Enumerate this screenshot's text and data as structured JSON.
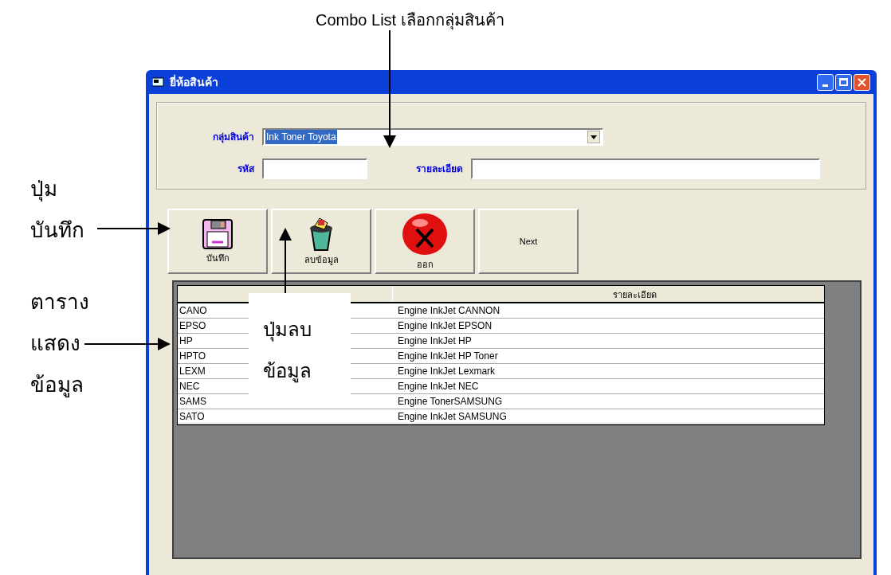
{
  "caption": "Combo List เลือกกลุ่มสินค้า",
  "side_notes": [
    {
      "lines": [
        "ปุ่ม",
        "บันทึก"
      ]
    },
    {
      "lines": [
        "ตาราง",
        "แสดง",
        "ข้อมูล"
      ]
    }
  ],
  "overlay_note": {
    "lines": [
      "ปุ่มลบ",
      "ข้อมูล"
    ]
  },
  "window": {
    "title": "ยี่ห้อสินค้า"
  },
  "form": {
    "group": {
      "label": "กลุ่มสินค้า",
      "value": "Ink Toner Toyota",
      "highlighted": true
    },
    "code": {
      "label": "รหัส"
    },
    "detail": {
      "label": "รายละเอียด"
    }
  },
  "buttons": [
    {
      "kind": "save",
      "label": "บันทึก"
    },
    {
      "kind": "delete",
      "label": "ลบข้อมูล"
    },
    {
      "kind": "exit",
      "label": "ออก"
    },
    {
      "kind": "text",
      "label": "Next"
    }
  ],
  "table": {
    "header": "รายละเอียด",
    "rows": [
      {
        "code": "CANO",
        "description": "Engine InkJet CANNON"
      },
      {
        "code": "EPSO",
        "description": "Engine InkJet EPSON"
      },
      {
        "code": "HP",
        "description": "Engine InkJet HP"
      },
      {
        "code": "HPTO",
        "description": "Engine InkJet HP Toner"
      },
      {
        "code": "LEXM",
        "description": "Engine InkJet Lexmark"
      },
      {
        "code": "NEC",
        "description": "Engine InkJet NEC"
      },
      {
        "code": "SAMS",
        "description": "Engine TonerSAMSUNG"
      },
      {
        "code": "SATO",
        "description": "Engine InkJet SAMSUNG"
      }
    ]
  }
}
